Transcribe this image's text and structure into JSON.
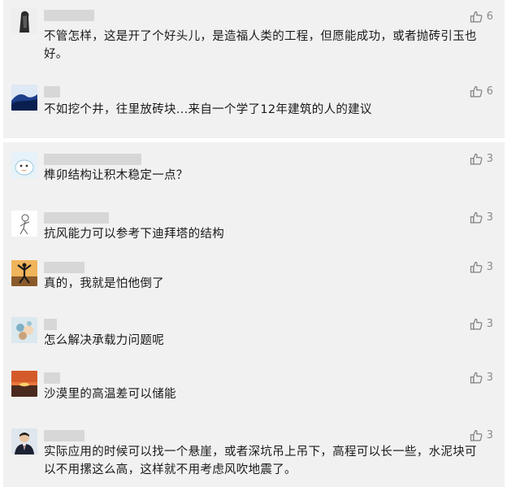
{
  "icons": {
    "like": "thumbs-up-icon"
  },
  "comments": [
    {
      "nickname": "",
      "text": "不管怎样，这是开了个好头儿，是造福人类的工程，但愿能成功，或者抛砖引玉也好。",
      "likes": "6"
    },
    {
      "nickname": "",
      "text": "不如挖个井，往里放砖块...来自一个学了12年建筑的人的建议",
      "likes": "6"
    },
    {
      "nickname": "",
      "text": "榫卯结构让积木稳定一点？",
      "likes": "3"
    },
    {
      "nickname": "",
      "text": "抗风能力可以参考下迪拜塔的结构",
      "likes": "3"
    },
    {
      "nickname": "",
      "text": "真的，我就是怕他倒了",
      "likes": "3"
    },
    {
      "nickname": "",
      "text": "怎么解决承载力问题呢",
      "likes": "3"
    },
    {
      "nickname": "",
      "text": "沙漠里的高温差可以储能",
      "likes": "3"
    },
    {
      "nickname": "",
      "text": "实际应用的时候可以找一个悬崖，或者深坑吊上吊下，高程可以长一些，水泥块可以不用摞这么高，这样就不用考虑风吹地震了。",
      "likes": "3"
    }
  ]
}
